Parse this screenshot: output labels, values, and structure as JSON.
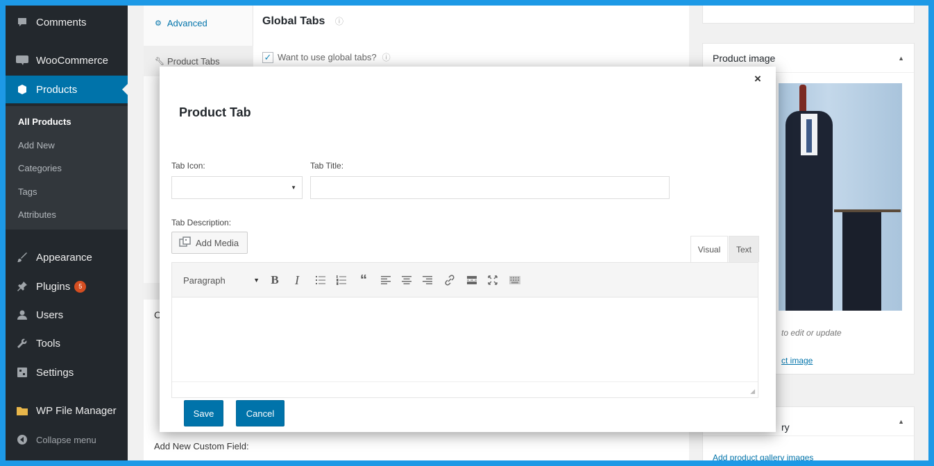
{
  "sidebar": {
    "menu_top": [
      {
        "label": "Comments",
        "icon": "comment-icon"
      },
      {
        "label": "WooCommerce",
        "icon": "woocommerce-icon"
      },
      {
        "label": "Products",
        "icon": "products-icon"
      }
    ],
    "submenu": [
      "All Products",
      "Add New",
      "Categories",
      "Tags",
      "Attributes"
    ],
    "menu_bottom": [
      {
        "label": "Appearance",
        "icon": "brush-icon"
      },
      {
        "label": "Plugins",
        "icon": "plugin-icon",
        "badge": "5"
      },
      {
        "label": "Users",
        "icon": "users-icon"
      },
      {
        "label": "Tools",
        "icon": "wrench-icon"
      },
      {
        "label": "Settings",
        "icon": "settings-icon"
      },
      {
        "label": "WP File Manager",
        "icon": "folder-icon"
      }
    ],
    "collapse_label": "Collapse menu"
  },
  "background": {
    "tabs": [
      "Advanced",
      "Product Tabs"
    ],
    "panel_title": "Global Tabs",
    "global_tabs_checkbox": "Want to use global tabs?",
    "lower_letter": "C",
    "custom_field_label": "Add New Custom Field:"
  },
  "right_panel": {
    "product_image_title": "Product image",
    "image_hint": "to edit or update",
    "image_link": "ct image",
    "gallery_title_fragment": "ry",
    "gallery_link": "Add product gallery images"
  },
  "modal": {
    "title": "Product Tab",
    "close_symbol": "×",
    "tab_icon_label": "Tab Icon:",
    "tab_title_label": "Tab Title:",
    "tab_title_value": "",
    "tab_description_label": "Tab Description:",
    "add_media_label": "Add Media",
    "mode_tabs": [
      "Visual",
      "Text"
    ],
    "format_select": "Paragraph",
    "save_label": "Save",
    "cancel_label": "Cancel"
  },
  "colors": {
    "accent": "#0073aa",
    "sidebar_bg": "#23282d",
    "frame": "#1d99e6",
    "badge": "#d54e21"
  }
}
